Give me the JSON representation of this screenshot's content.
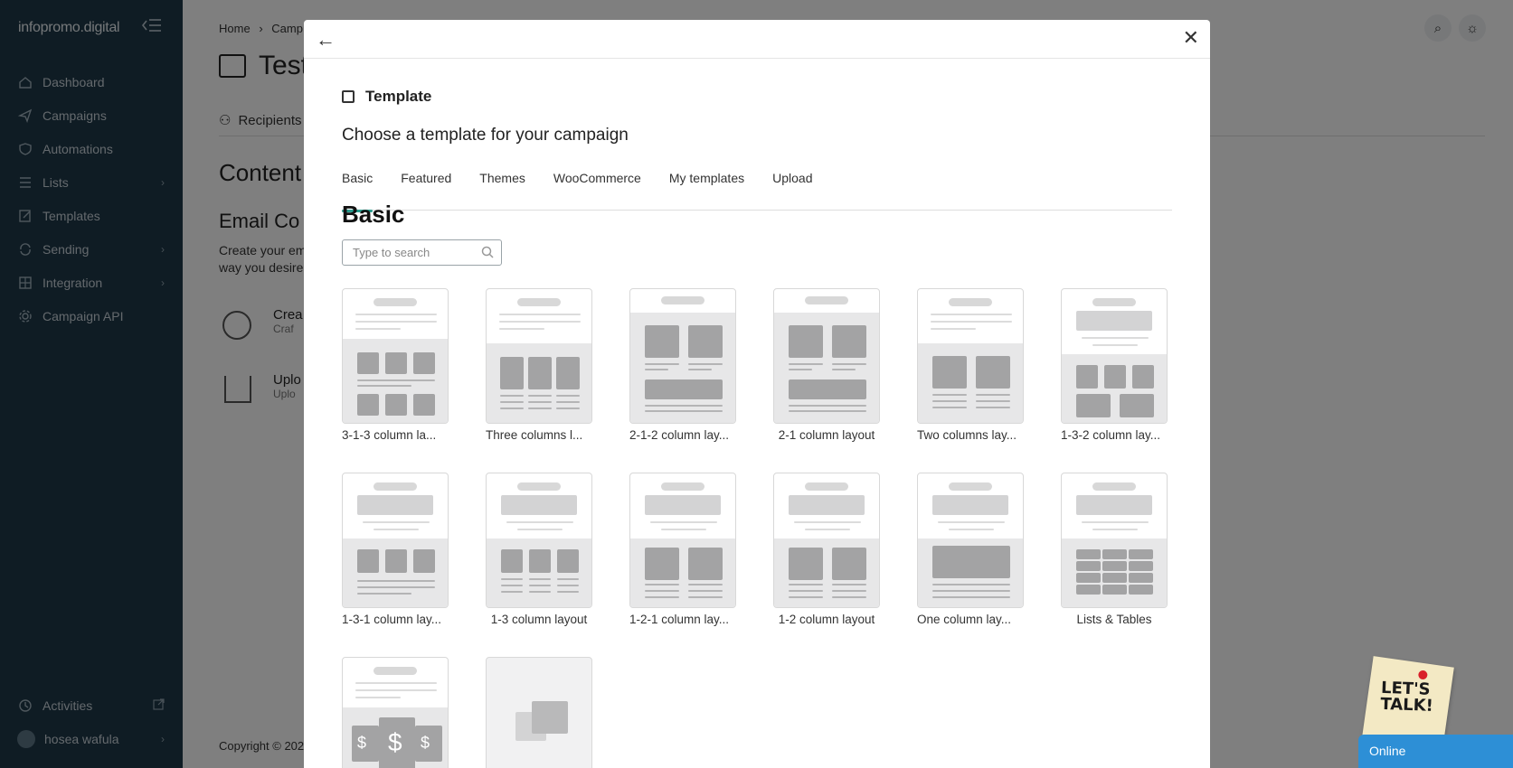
{
  "brand": {
    "name": "infopromo.digital"
  },
  "sidebar": {
    "items": [
      {
        "label": "Dashboard",
        "icon": "home-icon",
        "chevron": false
      },
      {
        "label": "Campaigns",
        "icon": "send-icon",
        "chevron": false
      },
      {
        "label": "Automations",
        "icon": "shield-icon",
        "chevron": false
      },
      {
        "label": "Lists",
        "icon": "list-icon",
        "chevron": true
      },
      {
        "label": "Templates",
        "icon": "edit-icon",
        "chevron": false
      },
      {
        "label": "Sending",
        "icon": "sync-icon",
        "chevron": true
      },
      {
        "label": "Integration",
        "icon": "integration-icon",
        "chevron": true
      },
      {
        "label": "Campaign API",
        "icon": "gear-icon",
        "chevron": false
      }
    ],
    "activities": "Activities",
    "user": "hosea wafula"
  },
  "page": {
    "breadcrumb_home": "Home",
    "breadcrumb_sep": "›",
    "breadcrumb_current": "Camp",
    "title": "Test",
    "recipients_tab": "Recipients",
    "content_heading": "Content",
    "email_heading": "Email Co",
    "email_desc_1": "Create your em",
    "email_desc_2": "way you desire",
    "option_create": "Crea",
    "option_create_sub": "Craf",
    "option_upload": "Uplo",
    "option_upload_sub": "Uplo",
    "copyright": "Copyright © 202"
  },
  "modal": {
    "section_title": "Template",
    "subtitle": "Choose a template for your campaign",
    "tabs": [
      "Basic",
      "Featured",
      "Themes",
      "WooCommerce",
      "My templates",
      "Upload"
    ],
    "active_tab": "Basic",
    "heading": "Basic",
    "search_placeholder": "Type to search",
    "templates": [
      {
        "label": "3-1-3 column la...",
        "kind": "313"
      },
      {
        "label": "Three columns l...",
        "kind": "three"
      },
      {
        "label": "2-1-2 column lay...",
        "kind": "212"
      },
      {
        "label": "2-1 column layout",
        "kind": "21"
      },
      {
        "label": "Two columns lay...",
        "kind": "two"
      },
      {
        "label": "1-3-2 column lay...",
        "kind": "132"
      },
      {
        "label": "1-3-1 column lay...",
        "kind": "131"
      },
      {
        "label": "1-3 column layout",
        "kind": "13"
      },
      {
        "label": "1-2-1 column lay...",
        "kind": "121"
      },
      {
        "label": "1-2 column layout",
        "kind": "12"
      },
      {
        "label": "One column lay...",
        "kind": "one"
      },
      {
        "label": "Lists & Tables",
        "kind": "tables"
      },
      {
        "label": "",
        "kind": "pricing"
      },
      {
        "label": "",
        "kind": "blank"
      }
    ]
  },
  "chat": {
    "badge": "LET'S TALK!",
    "status": "Online"
  }
}
